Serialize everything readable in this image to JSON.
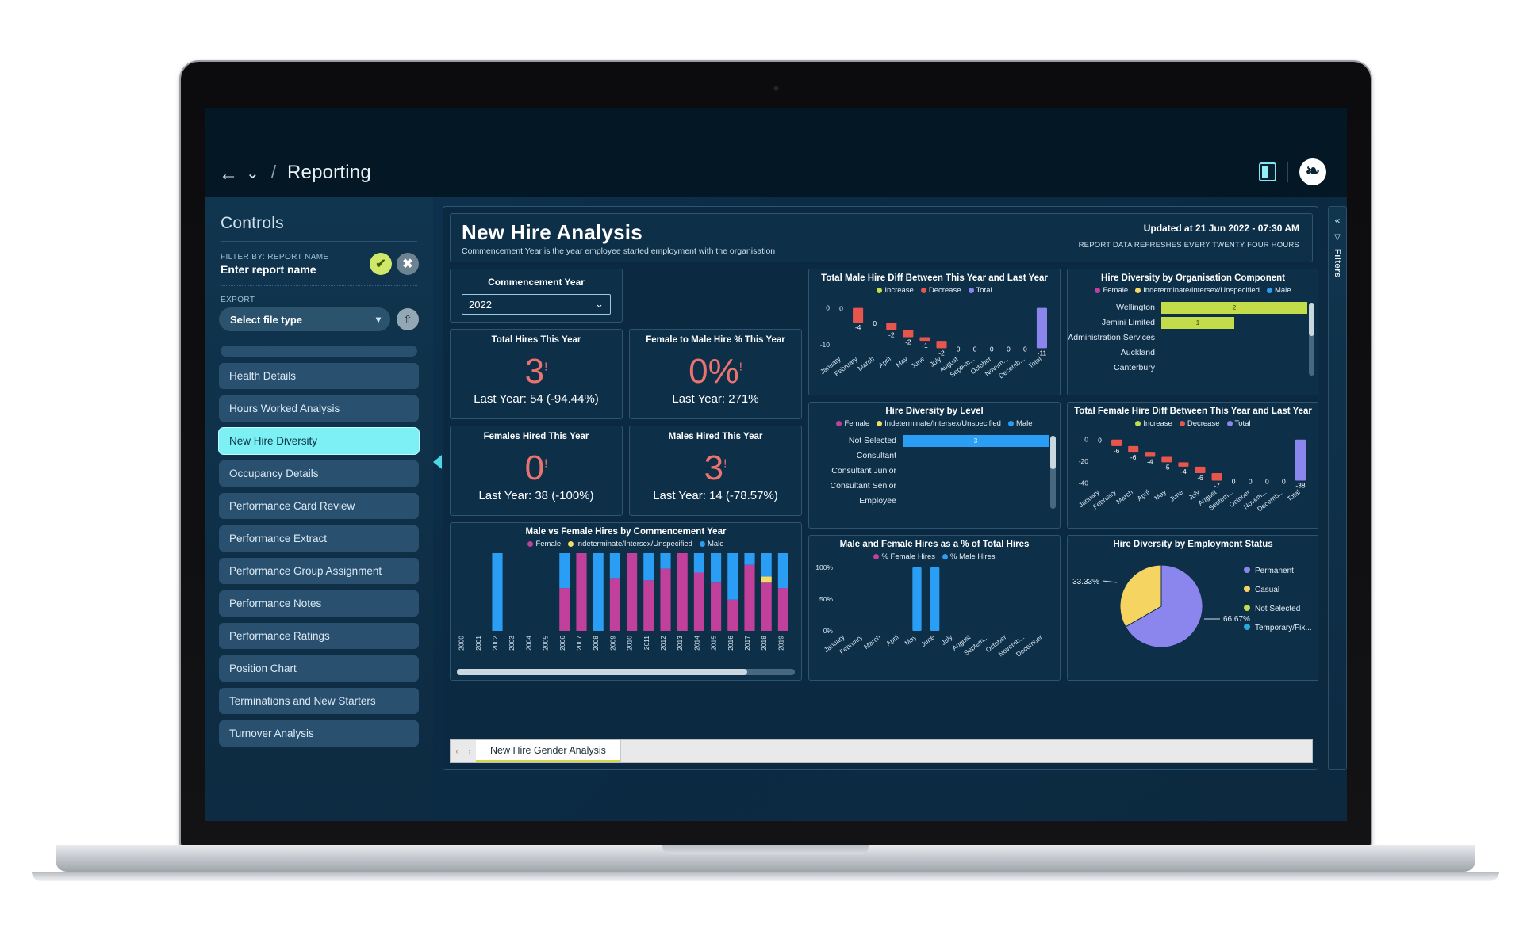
{
  "nav": {
    "breadcrumb_separator": "/",
    "breadcrumb": "Reporting",
    "back_icon": "←",
    "caret_icon": "⌄",
    "avatar_initial": "❧"
  },
  "sidebar": {
    "title": "Controls",
    "filter_label": "FILTER BY: REPORT NAME",
    "filter_value": "Enter report name",
    "confirm_icon": "✔",
    "clear_icon": "✖",
    "export_label": "EXPORT",
    "export_value": "Select file type",
    "export_caret": "▾",
    "export_icon": "⇧",
    "items": [
      {
        "label": "Health Details",
        "active": false
      },
      {
        "label": "Hours Worked Analysis",
        "active": false
      },
      {
        "label": "New Hire Diversity",
        "active": true
      },
      {
        "label": "Occupancy Details",
        "active": false
      },
      {
        "label": "Performance Card Review",
        "active": false
      },
      {
        "label": "Performance Extract",
        "active": false
      },
      {
        "label": "Performance Group Assignment",
        "active": false
      },
      {
        "label": "Performance Notes",
        "active": false
      },
      {
        "label": "Performance Ratings",
        "active": false
      },
      {
        "label": "Position Chart",
        "active": false
      },
      {
        "label": "Terminations and New Starters",
        "active": false
      },
      {
        "label": "Turnover Analysis",
        "active": false
      }
    ]
  },
  "rail": {
    "collapse_icon": "«",
    "filter_icon": "▽",
    "label": "Filters"
  },
  "header": {
    "title": "New Hire Analysis",
    "subtitle": "Commencement Year is the year employee started employment with the organisation",
    "updated": "Updated at 21 Jun 2022 - 07:30 AM",
    "refresh_note": "REPORT DATA REFRESHES EVERY TWENTY FOUR HOURS"
  },
  "commencement": {
    "title": "Commencement Year",
    "value": "2022",
    "caret": "⌄"
  },
  "kpis": [
    {
      "title": "Total Hires This Year",
      "value": "3",
      "flag": "!",
      "sub": "Last Year: 54 (-94.44%)"
    },
    {
      "title": "Female to Male Hire % This Year",
      "value": "0%",
      "flag": "!",
      "sub": "Last Year: 271%"
    },
    {
      "title": "Females Hired This Year",
      "value": "0",
      "flag": "!",
      "sub": "Last Year: 38 (-100%)"
    },
    {
      "title": "Males Hired This Year",
      "value": "3",
      "flag": "!",
      "sub": "Last Year: 14 (-78.57%)"
    }
  ],
  "tabs": {
    "prev_icon": "‹",
    "next_icon": "›",
    "items": [
      {
        "label": "New Hire Gender Analysis",
        "active": true
      }
    ]
  },
  "colors": {
    "female": "#c0409c",
    "indeterminate": "#f4dc64",
    "male": "#2a9df4",
    "increase": "#c3dd4a",
    "decrease": "#e8554d",
    "total": "#8b85ee",
    "permanent": "#8b85ee",
    "casual": "#f6d462",
    "not_selected": "#c3dd4a",
    "temporary": "#29a8e0"
  },
  "chart_data": [
    {
      "id": "male-hire-diff",
      "type": "bar",
      "title": "Total Male Hire Diff Between This Year and Last Year",
      "legend": [
        "Increase",
        "Decrease",
        "Total"
      ],
      "legend_position": "top",
      "categories": [
        "January",
        "February",
        "March",
        "April",
        "May",
        "June",
        "July",
        "August",
        "Septem...",
        "October",
        "Novem...",
        "Decemb...",
        "Total"
      ],
      "values": [
        0,
        -4,
        0,
        -2,
        -2,
        -1,
        -2,
        0,
        0,
        0,
        0,
        0,
        -11
      ],
      "labels": [
        "0",
        "-4",
        "0",
        "-2",
        "-2",
        "-1",
        "-2",
        "0",
        "0",
        "0",
        "0",
        "0",
        "-11"
      ],
      "kinds": [
        "none",
        "decrease",
        "none",
        "decrease",
        "decrease",
        "decrease",
        "decrease",
        "none",
        "none",
        "none",
        "none",
        "none",
        "total"
      ],
      "ylabel": "",
      "xlabel": "",
      "yticks": [
        0,
        -10
      ],
      "ytick_labels": [
        "0",
        "-10"
      ],
      "ylim": [
        -12,
        1
      ],
      "grid": false
    },
    {
      "id": "org-component",
      "type": "bar",
      "orientation": "horizontal",
      "title": "Hire Diversity by Organisation Component",
      "legend": [
        "Female",
        "Indeterminate/Intersex/Unspecified",
        "Male"
      ],
      "legend_position": "top",
      "categories": [
        "Wellington",
        "Jemini Limited",
        "Administration Services",
        "Auckland",
        "Canterbury"
      ],
      "series": [
        {
          "name": "Male",
          "values": [
            2,
            1,
            0,
            0,
            0
          ]
        }
      ],
      "labels": [
        "2",
        "1",
        "",
        "",
        ""
      ],
      "xlim": [
        0,
        2
      ],
      "grid": false
    },
    {
      "id": "diversity-by-level",
      "type": "bar",
      "orientation": "horizontal",
      "title": "Hire Diversity by Level",
      "legend": [
        "Female",
        "Indeterminate/Intersex/Unspecified",
        "Male"
      ],
      "legend_position": "top",
      "categories": [
        "Not Selected",
        "Consultant",
        "Consultant Junior",
        "Consultant Senior",
        "Employee"
      ],
      "series": [
        {
          "name": "Male",
          "values": [
            3,
            0,
            0,
            0,
            0
          ]
        }
      ],
      "labels": [
        "3",
        "",
        "",
        "",
        ""
      ],
      "xlim": [
        0,
        3
      ],
      "grid": false
    },
    {
      "id": "female-hire-diff",
      "type": "bar",
      "title": "Total Female Hire Diff Between This Year and Last Year",
      "legend": [
        "Increase",
        "Decrease",
        "Total"
      ],
      "legend_position": "top",
      "categories": [
        "January",
        "February",
        "March",
        "April",
        "May",
        "June",
        "July",
        "August",
        "Septem...",
        "October",
        "Novem...",
        "Decemb...",
        "Total"
      ],
      "values": [
        0,
        -6,
        -6,
        -4,
        -5,
        -4,
        -6,
        -7,
        0,
        0,
        0,
        0,
        -38
      ],
      "labels": [
        "0",
        "-6",
        "-6",
        "-4",
        "-5",
        "-4",
        "-6",
        "-7",
        "0",
        "0",
        "0",
        "0",
        "-38"
      ],
      "kinds": [
        "none",
        "decrease",
        "decrease",
        "decrease",
        "decrease",
        "decrease",
        "decrease",
        "decrease",
        "none",
        "none",
        "none",
        "none",
        "total"
      ],
      "yticks": [
        0,
        -20,
        -40
      ],
      "ytick_labels": [
        "0",
        "-20",
        "-40"
      ],
      "ylim": [
        -42,
        2
      ],
      "grid": false
    },
    {
      "id": "male-female-by-year",
      "type": "bar",
      "stacked": true,
      "title": "Male vs Female Hires by Commencement Year",
      "legend": [
        "Female",
        "Indeterminate/Intersex/Unspecified",
        "Male"
      ],
      "legend_position": "top",
      "categories": [
        "2000",
        "2001",
        "2002",
        "2003",
        "2004",
        "2005",
        "2006",
        "2007",
        "2008",
        "2009",
        "2010",
        "2011",
        "2012",
        "2013",
        "2014",
        "2015",
        "2016",
        "2017",
        "2018",
        "2019"
      ],
      "series": [
        {
          "name": "Female",
          "values": [
            0,
            0,
            0,
            0,
            0,
            0,
            55,
            100,
            0,
            68,
            100,
            65,
            80,
            100,
            75,
            62,
            40,
            85,
            62,
            55
          ]
        },
        {
          "name": "Indeterminate/Intersex/Unspecified",
          "values": [
            0,
            0,
            0,
            0,
            0,
            0,
            0,
            0,
            0,
            0,
            0,
            0,
            0,
            0,
            0,
            0,
            0,
            0,
            8,
            0
          ]
        },
        {
          "name": "Male",
          "values": [
            0,
            0,
            100,
            0,
            0,
            0,
            45,
            0,
            100,
            32,
            0,
            35,
            20,
            0,
            25,
            38,
            60,
            15,
            30,
            45
          ]
        }
      ],
      "xlabel": "",
      "ylabel": "",
      "grid": false,
      "scrollbar": true
    },
    {
      "id": "pct-of-total-hires",
      "type": "bar",
      "title": "Male and Female Hires as a % of Total Hires",
      "legend": [
        "% Female Hires",
        "% Male Hires"
      ],
      "legend_position": "top",
      "categories": [
        "January",
        "February",
        "March",
        "April",
        "May",
        "June",
        "July",
        "August",
        "Septem...",
        "October",
        "Novemb...",
        "December"
      ],
      "series": [
        {
          "name": "% Female Hires",
          "values": [
            0,
            0,
            0,
            0,
            0,
            0,
            0,
            0,
            0,
            0,
            0,
            0
          ]
        },
        {
          "name": "% Male Hires",
          "values": [
            0,
            0,
            0,
            0,
            100,
            100,
            0,
            0,
            0,
            0,
            0,
            0
          ]
        }
      ],
      "yticks": [
        0,
        50,
        100
      ],
      "ytick_labels": [
        "0%",
        "50%",
        "100%"
      ],
      "ylim": [
        0,
        100
      ],
      "grid": false
    },
    {
      "id": "employment-status",
      "type": "pie",
      "title": "Hire Diversity by Employment Status",
      "labels": [
        "Permanent",
        "Casual",
        "Not Selected",
        "Temporary/Fix..."
      ],
      "values": [
        66.67,
        33.33,
        0,
        0
      ],
      "value_labels": [
        "66.67%",
        "33.33%"
      ],
      "legend_position": "right"
    }
  ]
}
